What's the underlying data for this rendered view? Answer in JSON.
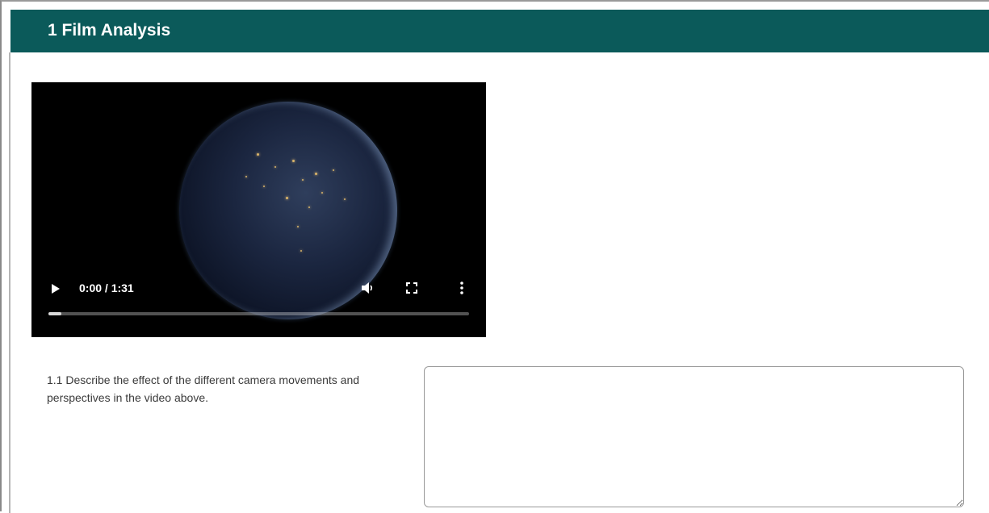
{
  "section": {
    "title": "1 Film Analysis",
    "header_color": "#0b5a5a"
  },
  "video": {
    "time_display": "0:00 / 1:31",
    "progress_fraction": 0.03,
    "icons": {
      "play": "play-icon",
      "volume": "volume-icon",
      "fullscreen": "fullscreen-icon",
      "menu": "more-vertical-icon"
    }
  },
  "question": {
    "text": "1.1 Describe the effect of the different camera movements and perspectives in the video above.",
    "answer_value": "",
    "answer_placeholder": ""
  }
}
